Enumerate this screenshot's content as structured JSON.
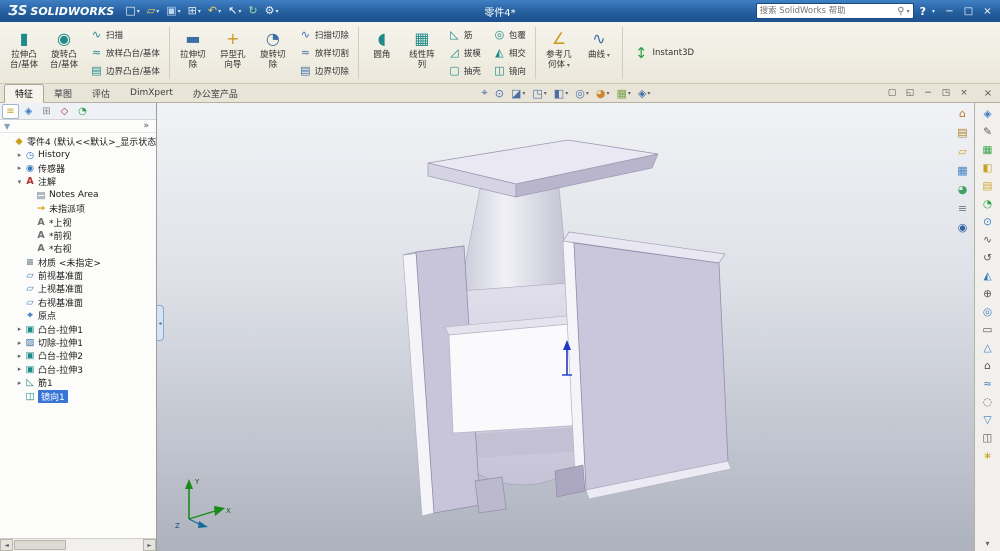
{
  "colors": {
    "titlebar_blue": "#2e6cb0",
    "selection_blue": "#3875d7",
    "model_face_purple": "#cac6dc",
    "viewport_gradient_top": "#f0f2f5",
    "viewport_gradient_bottom": "#adb2bd"
  },
  "titlebar": {
    "logo_prefix": "ƷS",
    "logo_text": "SOLIDWORKS",
    "document_title": "零件4*",
    "search_placeholder": "搜索 SolidWorks 帮助",
    "search_mag_glyph": "⚲",
    "help_glyph": "?",
    "quick_access": [
      {
        "name": "new-document-icon",
        "glyph": "□",
        "color": "#f2f6fb",
        "caret": true
      },
      {
        "name": "open-icon",
        "glyph": "▱",
        "color": "#f3cf63",
        "caret": true
      },
      {
        "name": "save-icon",
        "glyph": "▣",
        "color": "#bcd6f2",
        "caret": true
      },
      {
        "name": "print-icon",
        "glyph": "⊞",
        "color": "#dfe8f4",
        "caret": true
      },
      {
        "name": "undo-icon",
        "glyph": "↶",
        "color": "#f3cf63",
        "caret": true
      },
      {
        "name": "select-icon",
        "glyph": "↖",
        "color": "#ffffff",
        "caret": true
      },
      {
        "name": "rebuild-icon",
        "glyph": "↻",
        "color": "#9fd8a0",
        "caret": false
      },
      {
        "name": "options-icon",
        "glyph": "⚙",
        "color": "#e8edf4",
        "caret": true
      }
    ],
    "window_controls": [
      {
        "name": "minimize-icon",
        "glyph": "−"
      },
      {
        "name": "maximize-icon",
        "glyph": "□"
      },
      {
        "name": "close-icon",
        "glyph": "×"
      }
    ]
  },
  "ribbon": {
    "items": [
      {
        "type": "large",
        "name": "extruded-boss-button",
        "icon": "extruded-boss-icon",
        "glyph": "▮",
        "color": "#1f8a8a",
        "label": "拉伸凸\n台/基体"
      },
      {
        "type": "large",
        "name": "revolved-boss-button",
        "icon": "revolved-boss-icon",
        "glyph": "◉",
        "color": "#1f8a8a",
        "label": "旋转凸\n台/基体"
      },
      {
        "type": "stack",
        "name": "boss-feature-stack",
        "items": [
          {
            "name": "swept-boss-button",
            "icon": "swept-boss-icon",
            "glyph": "∿",
            "color": "#1f8a8a",
            "label": "扫描"
          },
          {
            "name": "lofted-boss-button",
            "icon": "lofted-boss-icon",
            "glyph": "≈",
            "color": "#1f8a8a",
            "label": "放样凸台/基体"
          },
          {
            "name": "boundary-boss-button",
            "icon": "boundary-boss-icon",
            "glyph": "▤",
            "color": "#1f8a8a",
            "label": "边界凸台/基体"
          }
        ]
      },
      {
        "type": "sep"
      },
      {
        "type": "large",
        "name": "extruded-cut-button",
        "icon": "extruded-cut-icon",
        "glyph": "▬",
        "color": "#3a6ea5",
        "label": "拉伸切\n除"
      },
      {
        "type": "large",
        "name": "hole-wizard-button",
        "icon": "hole-wizard-icon",
        "glyph": "+",
        "color": "#c99a1e",
        "label": "异型孔\n向导"
      },
      {
        "type": "large",
        "name": "revolved-cut-button",
        "icon": "revolved-cut-icon",
        "glyph": "◔",
        "color": "#3a6ea5",
        "label": "旋转切\n除"
      },
      {
        "type": "stack",
        "name": "cut-feature-stack",
        "items": [
          {
            "name": "swept-cut-button",
            "icon": "swept-cut-icon",
            "glyph": "∿",
            "color": "#3a6ea5",
            "label": "扫描切除"
          },
          {
            "name": "lofted-cut-button",
            "icon": "lofted-cut-icon",
            "glyph": "≈",
            "color": "#3a6ea5",
            "label": "放样切割"
          },
          {
            "name": "boundary-cut-button",
            "icon": "boundary-cut-icon",
            "glyph": "▤",
            "color": "#3a6ea5",
            "label": "边界切除"
          }
        ]
      },
      {
        "type": "sep"
      },
      {
        "type": "large",
        "name": "fillet-button",
        "icon": "fillet-icon",
        "glyph": "◖",
        "color": "#1f8a8a",
        "label": "圆角"
      },
      {
        "type": "large",
        "name": "linear-pattern-button",
        "icon": "linear-pattern-icon",
        "glyph": "▦",
        "color": "#1f8a8a",
        "label": "线性阵\n列"
      },
      {
        "type": "stack",
        "name": "rib-draft-shell-stack",
        "items": [
          {
            "name": "rib-button",
            "icon": "rib-icon",
            "glyph": "◺",
            "color": "#1f8a8a",
            "label": "筋"
          },
          {
            "name": "draft-button",
            "icon": "draft-icon",
            "glyph": "◿",
            "color": "#1f8a8a",
            "label": "拔模"
          },
          {
            "name": "shell-button",
            "icon": "shell-icon",
            "glyph": "▢",
            "color": "#1f8a8a",
            "label": "抽壳"
          }
        ]
      },
      {
        "type": "stack",
        "name": "wrap-intersect-mirror-stack",
        "items": [
          {
            "name": "wrap-button",
            "icon": "wrap-icon",
            "glyph": "◎",
            "color": "#1f8a8a",
            "label": "包覆"
          },
          {
            "name": "intersect-button",
            "icon": "intersect-icon",
            "glyph": "◭",
            "color": "#1f8a8a",
            "label": "相交"
          },
          {
            "name": "mirror-button",
            "icon": "mirror-icon",
            "glyph": "◫",
            "color": "#1f8a8a",
            "label": "镜向"
          }
        ]
      },
      {
        "type": "sep"
      },
      {
        "type": "large",
        "name": "reference-geometry-button",
        "icon": "reference-geometry-icon",
        "glyph": "∠",
        "color": "#c99a1e",
        "label": "参考几\n何体",
        "caret": true
      },
      {
        "type": "large",
        "name": "curves-button",
        "icon": "curves-icon",
        "glyph": "∿",
        "color": "#3a6ea5",
        "label": "曲线",
        "caret": true
      },
      {
        "type": "sep"
      },
      {
        "type": "wide",
        "name": "instant3d-button",
        "icon": "instant3d-icon",
        "glyph": "↕",
        "color": "#2ea043",
        "label": "Instant3D"
      }
    ]
  },
  "tabs": {
    "active": "特征",
    "items": [
      "特征",
      "草图",
      "评估",
      "DimXpert",
      "办公室产品"
    ]
  },
  "hud": [
    {
      "name": "zoom-fit-icon",
      "glyph": "⌖",
      "color": "#4a6da7",
      "caret": false
    },
    {
      "name": "zoom-area-icon",
      "glyph": "⊙",
      "color": "#4a6da7",
      "caret": false
    },
    {
      "name": "section-view-icon",
      "glyph": "◪",
      "color": "#4a6da7",
      "caret": true
    },
    {
      "name": "view-orientation-icon",
      "glyph": "◳",
      "color": "#4a6da7",
      "caret": true
    },
    {
      "name": "display-style-icon",
      "glyph": "◧",
      "color": "#4a6da7",
      "caret": true
    },
    {
      "name": "hide-show-items-icon",
      "glyph": "◎",
      "color": "#4a6da7",
      "caret": true
    },
    {
      "name": "edit-appearance-icon",
      "glyph": "◕",
      "color": "#cc8833",
      "caret": true
    },
    {
      "name": "apply-scene-icon",
      "glyph": "▦",
      "color": "#7aa34d",
      "caret": true
    },
    {
      "name": "view-settings-icon",
      "glyph": "◈",
      "color": "#4a6da7",
      "caret": true
    }
  ],
  "viewport_controls": [
    {
      "name": "new-window-icon",
      "glyph": "▢"
    },
    {
      "name": "tile-windows-icon",
      "glyph": "◱"
    },
    {
      "name": "minimize-document-icon",
      "glyph": "−"
    },
    {
      "name": "restore-document-icon",
      "glyph": "◳"
    },
    {
      "name": "close-document-icon",
      "glyph": "×"
    }
  ],
  "left_panel": {
    "overflow_glyph": "»",
    "filter_glyph": "▼",
    "scrollbar": {
      "left": "◄",
      "right": "►"
    },
    "tabs": [
      {
        "name": "featuremanager-tab",
        "glyph": "≡",
        "color": "#caa020",
        "active": true
      },
      {
        "name": "propertymanager-tab",
        "glyph": "◈",
        "color": "#3a7abf",
        "active": false
      },
      {
        "name": "configurationmanager-tab",
        "glyph": "⊞",
        "color": "#888888",
        "active": false
      },
      {
        "name": "dimxpertmanager-tab",
        "glyph": "◇",
        "color": "#b03030",
        "active": false
      },
      {
        "name": "displaymanager-tab",
        "glyph": "◔",
        "color": "#2ea043",
        "active": false
      }
    ]
  },
  "tree": {
    "items": [
      {
        "name": "tree-root-part",
        "label": "零件4 (默认<<默认>_显示状态",
        "icon": "part-icon",
        "glyph": "◆",
        "color": "#caa020",
        "indent": 0,
        "toggle": "none",
        "selected": false
      },
      {
        "name": "tree-item-history",
        "label": "History",
        "icon": "history-folder-icon",
        "glyph": "◷",
        "color": "#3a7abf",
        "indent": 1,
        "toggle": "collapsed",
        "selected": false
      },
      {
        "name": "tree-item-sensors",
        "label": "传感器",
        "icon": "sensors-icon",
        "glyph": "◉",
        "color": "#3a7abf",
        "indent": 1,
        "toggle": "collapsed",
        "selected": false
      },
      {
        "name": "tree-item-annotations",
        "label": "注解",
        "icon": "annotations-icon",
        "glyph": "A",
        "color": "#b03030",
        "indent": 1,
        "toggle": "expanded",
        "selected": false
      },
      {
        "name": "tree-item-notes-area",
        "label": "Notes Area",
        "icon": "notes-area-icon",
        "glyph": "▤",
        "color": "#6a7a8a",
        "indent": 2,
        "toggle": "none",
        "selected": false
      },
      {
        "name": "tree-item-unassigned",
        "label": "未指派项",
        "icon": "unassigned-items-icon",
        "glyph": "→",
        "color": "#d89a00",
        "indent": 2,
        "toggle": "none",
        "selected": false
      },
      {
        "name": "tree-item-top-view",
        "label": "*上视",
        "icon": "annotation-view-icon",
        "glyph": "A",
        "color": "#707070",
        "indent": 2,
        "toggle": "none",
        "selected": false
      },
      {
        "name": "tree-item-front-view",
        "label": "*前视",
        "icon": "annotation-view-icon",
        "glyph": "A",
        "color": "#707070",
        "indent": 2,
        "toggle": "none",
        "selected": false
      },
      {
        "name": "tree-item-right-view",
        "label": "*右视",
        "icon": "annotation-view-icon",
        "glyph": "A",
        "color": "#707070",
        "indent": 2,
        "toggle": "none",
        "selected": false
      },
      {
        "name": "tree-item-material",
        "label": "材质 <未指定>",
        "icon": "material-icon",
        "glyph": "≡",
        "color": "#607080",
        "indent": 1,
        "toggle": "none",
        "selected": false
      },
      {
        "name": "tree-item-front-plane",
        "label": "前视基准面",
        "icon": "plane-icon",
        "glyph": "▱",
        "color": "#3a7abf",
        "indent": 1,
        "toggle": "none",
        "selected": false
      },
      {
        "name": "tree-item-top-plane",
        "label": "上视基准面",
        "icon": "plane-icon",
        "glyph": "▱",
        "color": "#3a7abf",
        "indent": 1,
        "toggle": "none",
        "selected": false
      },
      {
        "name": "tree-item-right-plane",
        "label": "右视基准面",
        "icon": "plane-icon",
        "glyph": "▱",
        "color": "#3a7abf",
        "indent": 1,
        "toggle": "none",
        "selected": false
      },
      {
        "name": "tree-item-origin",
        "label": "原点",
        "icon": "origin-icon",
        "glyph": "⌖",
        "color": "#3a7abf",
        "indent": 1,
        "toggle": "none",
        "selected": false
      },
      {
        "name": "tree-item-boss-extrude1",
        "label": "凸台-拉伸1",
        "icon": "boss-extrude-icon",
        "glyph": "▣",
        "color": "#1f8a8a",
        "indent": 1,
        "toggle": "collapsed",
        "selected": false
      },
      {
        "name": "tree-item-cut-extrude1",
        "label": "切除-拉伸1",
        "icon": "cut-extrude-icon",
        "glyph": "▨",
        "color": "#3a6ea5",
        "indent": 1,
        "toggle": "collapsed",
        "selected": false
      },
      {
        "name": "tree-item-boss-extrude2",
        "label": "凸台-拉伸2",
        "icon": "boss-extrude-icon",
        "glyph": "▣",
        "color": "#1f8a8a",
        "indent": 1,
        "toggle": "collapsed",
        "selected": false
      },
      {
        "name": "tree-item-boss-extrude3",
        "label": "凸台-拉伸3",
        "icon": "boss-extrude-icon",
        "glyph": "▣",
        "color": "#1f8a8a",
        "indent": 1,
        "toggle": "collapsed",
        "selected": false
      },
      {
        "name": "tree-item-rib1",
        "label": "筋1",
        "icon": "rib-icon",
        "glyph": "◺",
        "color": "#1f8a8a",
        "indent": 1,
        "toggle": "collapsed",
        "selected": false
      },
      {
        "name": "tree-item-mirror1",
        "label": "镜向1",
        "icon": "mirror-icon",
        "glyph": "◫",
        "color": "#1f8a8a",
        "indent": 1,
        "toggle": "none",
        "selected": true
      }
    ]
  },
  "task_pane": [
    {
      "name": "solidworks-resources-icon",
      "glyph": "⌂",
      "color": "#c07820"
    },
    {
      "name": "design-library-icon",
      "glyph": "▤",
      "color": "#b08030"
    },
    {
      "name": "file-explorer-icon",
      "glyph": "▱",
      "color": "#d8a020"
    },
    {
      "name": "view-palette-icon",
      "glyph": "▦",
      "color": "#4080c0"
    },
    {
      "name": "appearances-scenes-icon",
      "glyph": "◕",
      "color": "#40a060"
    },
    {
      "name": "custom-properties-icon",
      "glyph": "≡",
      "color": "#707880"
    },
    {
      "name": "forum-icon",
      "glyph": "◉",
      "color": "#3060a0"
    }
  ],
  "right_toolbar": {
    "close_glyph": "×",
    "chevron_glyph": "▾",
    "icons": [
      {
        "name": "tool-icon-1",
        "glyph": "◈",
        "color": "#3a7abf"
      },
      {
        "name": "tool-icon-2",
        "glyph": "✎",
        "color": "#555555"
      },
      {
        "name": "tool-icon-3",
        "glyph": "▦",
        "color": "#2ea043"
      },
      {
        "name": "tool-icon-4",
        "glyph": "◧",
        "color": "#caa020"
      },
      {
        "name": "tool-icon-5",
        "glyph": "▤",
        "color": "#caa020"
      },
      {
        "name": "tool-icon-6",
        "glyph": "◔",
        "color": "#2ea043"
      },
      {
        "name": "tool-icon-7",
        "glyph": "⊙",
        "color": "#3a7abf"
      },
      {
        "name": "tool-icon-8",
        "glyph": "∿",
        "color": "#555555"
      },
      {
        "name": "tool-icon-9",
        "glyph": "↺",
        "color": "#555555"
      },
      {
        "name": "tool-icon-10",
        "glyph": "◭",
        "color": "#3a7abf"
      },
      {
        "name": "tool-icon-11",
        "glyph": "⊕",
        "color": "#555555"
      },
      {
        "name": "tool-icon-12",
        "glyph": "◎",
        "color": "#3a7abf"
      },
      {
        "name": "tool-icon-13",
        "glyph": "▭",
        "color": "#555555"
      },
      {
        "name": "tool-icon-14",
        "glyph": "△",
        "color": "#3a7abf"
      },
      {
        "name": "tool-icon-15",
        "glyph": "⌂",
        "color": "#555555"
      },
      {
        "name": "tool-icon-16",
        "glyph": "≈",
        "color": "#3a7abf"
      },
      {
        "name": "tool-icon-17",
        "glyph": "◌",
        "color": "#555555"
      },
      {
        "name": "tool-icon-18",
        "glyph": "▽",
        "color": "#3a7abf"
      },
      {
        "name": "tool-icon-19",
        "glyph": "◫",
        "color": "#555555"
      },
      {
        "name": "tool-icon-20",
        "glyph": "∗",
        "color": "#caa020"
      }
    ]
  },
  "triad": {
    "y": "Y",
    "x": "X",
    "z": "Z"
  }
}
